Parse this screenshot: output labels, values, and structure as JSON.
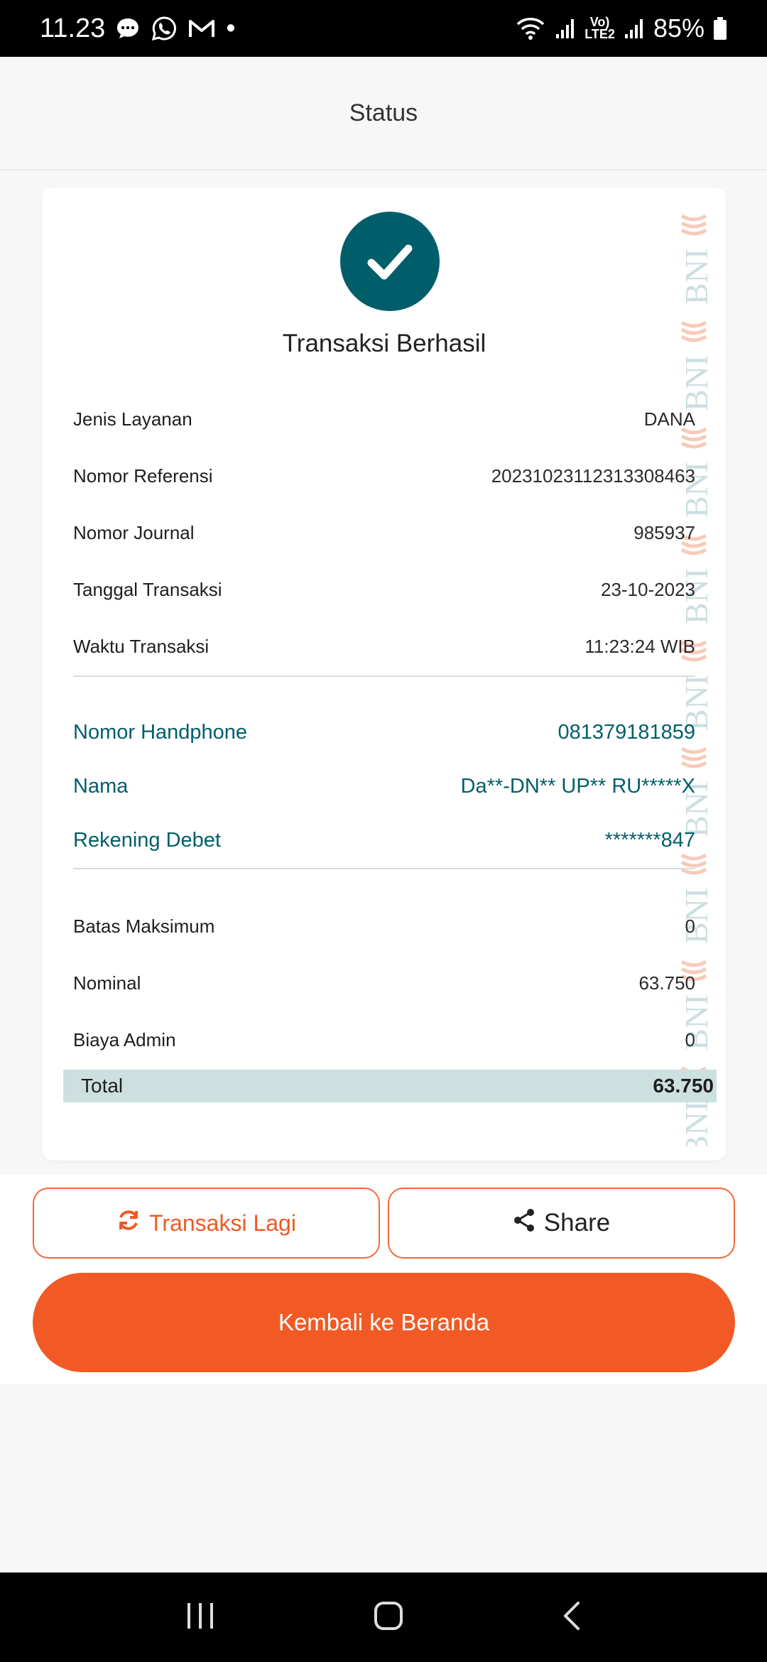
{
  "status_bar": {
    "time": "11.23",
    "dot": "•",
    "signal_label": "Vo)\nLTE2",
    "battery": "85%"
  },
  "header": {
    "title": "Status"
  },
  "receipt": {
    "status_title": "Transaksi Berhasil",
    "watermark_text": "BNI",
    "details": [
      {
        "label": "Jenis Layanan",
        "value": "DANA"
      },
      {
        "label": "Nomor Referensi",
        "value": "20231023112313308463"
      },
      {
        "label": "Nomor Journal",
        "value": "985937"
      },
      {
        "label": "Tanggal Transaksi",
        "value": "23-10-2023"
      },
      {
        "label": "Waktu Transaksi",
        "value": "11:23:24 WIB"
      }
    ],
    "customer": [
      {
        "label": "Nomor Handphone",
        "value": "081379181859"
      },
      {
        "label": "Nama",
        "value": "Da**-DN** UP** RU*****X"
      },
      {
        "label": "Rekening Debet",
        "value": "*******847"
      }
    ],
    "amounts": [
      {
        "label": "Batas Maksimum",
        "value": "0"
      },
      {
        "label": "Nominal",
        "value": "63.750"
      },
      {
        "label": "Biaya Admin",
        "value": "0"
      }
    ],
    "total": {
      "label": "Total",
      "value": "63.750"
    }
  },
  "actions": {
    "retry_label": "Transaksi Lagi",
    "share_label": "Share",
    "home_label": "Kembali ke Beranda"
  },
  "colors": {
    "brand_teal": "#005e6a",
    "accent_orange": "#f15a24",
    "total_bg": "#cde0e0"
  },
  "icons": {
    "status_bar": [
      "chat-bubble-icon",
      "whatsapp-icon",
      "gmail-icon",
      "wifi-icon",
      "signal-icon",
      "battery-icon"
    ],
    "receipt": [
      "check-circle-icon"
    ],
    "buttons": [
      "refresh-icon",
      "share-icon"
    ],
    "nav": [
      "recent-apps-icon",
      "home-icon",
      "back-icon"
    ]
  }
}
